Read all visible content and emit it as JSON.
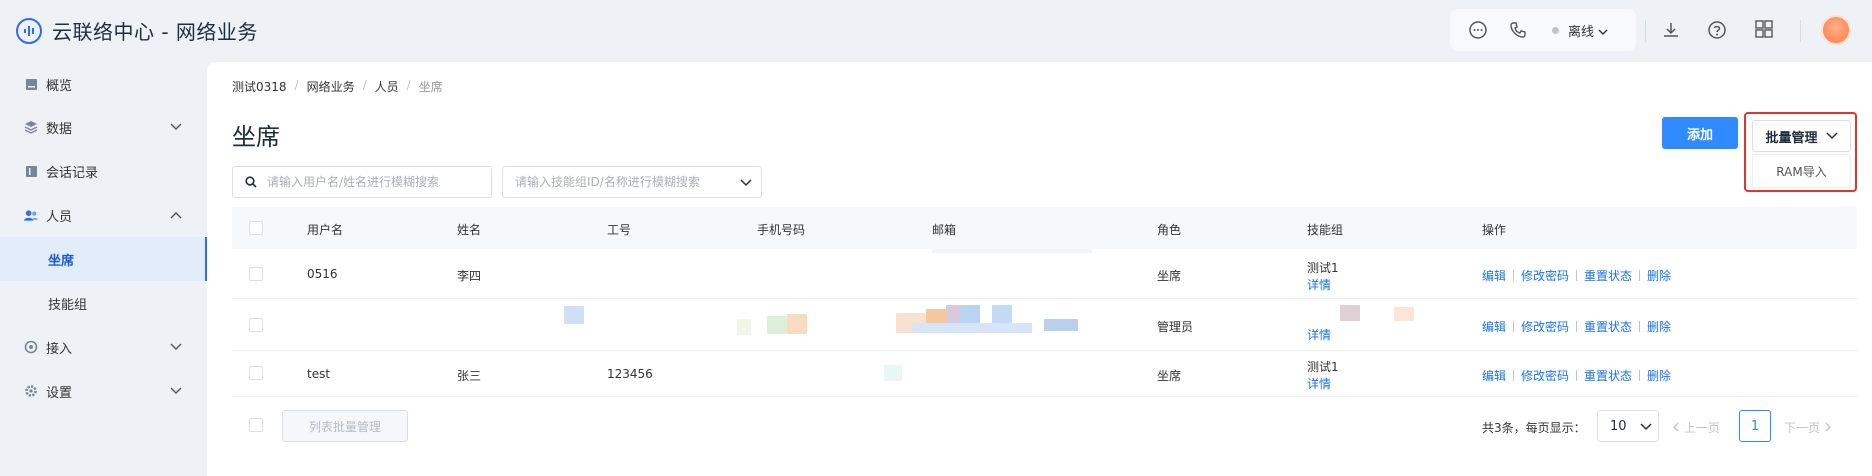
{
  "app": {
    "title": "云联络中心 - 网络业务"
  },
  "header": {
    "status": "离线"
  },
  "sidebar": {
    "items": [
      {
        "label": "概览",
        "icon": "overview-icon"
      },
      {
        "label": "数据",
        "icon": "data-icon"
      },
      {
        "label": "会话记录",
        "icon": "session-record-icon"
      },
      {
        "label": "人员",
        "icon": "people-icon"
      },
      {
        "label": "坐席",
        "active": true
      },
      {
        "label": "技能组"
      },
      {
        "label": "接入",
        "icon": "access-icon"
      },
      {
        "label": "设置",
        "icon": "settings-icon"
      }
    ]
  },
  "breadcrumb": [
    "测试0318",
    "网络业务",
    "人员",
    "坐席"
  ],
  "page": {
    "title": "坐席"
  },
  "toolbar": {
    "add_label": "添加",
    "batch_label": "批量管理",
    "batch_menu": [
      "RAM导入"
    ]
  },
  "filters": {
    "search_placeholder": "请输入用户名/姓名进行模糊搜索",
    "group_placeholder": "请输入技能组ID/名称进行模糊搜索"
  },
  "table": {
    "columns": [
      "用户名",
      "姓名",
      "工号",
      "手机号码",
      "邮箱",
      "角色",
      "技能组",
      "操作"
    ],
    "rows": [
      {
        "username": "0516",
        "name": "李四",
        "job_no": "",
        "phone": "",
        "email": "",
        "role": "坐席",
        "group": "测试1",
        "group_link": "详情"
      },
      {
        "username": "",
        "name": "",
        "job_no": "",
        "phone": "",
        "email": "",
        "role": "管理员",
        "group": "",
        "group_link": "详情"
      },
      {
        "username": "test",
        "name": "张三",
        "job_no": "123456",
        "phone": "",
        "email": "",
        "role": "坐席",
        "group": "测试1",
        "group_link": "详情"
      }
    ],
    "actions": [
      "编辑",
      "修改密码",
      "重置状态",
      "删除"
    ]
  },
  "footer": {
    "bulk_label": "列表批量管理",
    "total_text": "共3条，每页显示：",
    "page_size": "10",
    "prev_label": "上一页",
    "current_page": "1",
    "next_label": "下一页"
  },
  "colors": {
    "primary": "#2f8bff",
    "link": "#1a73e8",
    "highlight_border": "#e0362c"
  }
}
